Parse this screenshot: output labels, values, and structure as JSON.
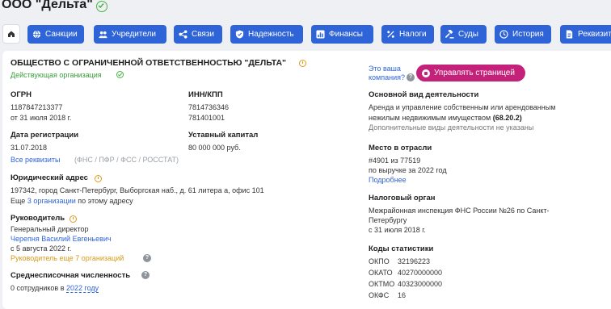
{
  "header": {
    "title": "ООО \"Дельта\""
  },
  "tabs": [
    {
      "label": "Санкции",
      "icon": "globe-icon"
    },
    {
      "label": "Учредители",
      "icon": "people-icon"
    },
    {
      "label": "Связи",
      "icon": "links-icon"
    },
    {
      "label": "Надежность",
      "icon": "shield-icon"
    },
    {
      "label": "Финансы",
      "icon": "chart-icon"
    },
    {
      "label": "Налоги",
      "icon": "percent-icon"
    },
    {
      "label": "Суды",
      "icon": "gavel-icon"
    },
    {
      "label": "История",
      "icon": "clock-icon"
    },
    {
      "label": "Реквизиты",
      "icon": "document-icon"
    }
  ],
  "company": {
    "full_name": "ОБЩЕСТВО С ОГРАНИЧЕННОЙ ОТВЕТСТВЕННОСТЬЮ \"ДЕЛЬТА\"",
    "status": "Действующая организация"
  },
  "ogrn": {
    "label": "ОГРН",
    "value": "1187847213377",
    "date": "от 31 июля 2018 г."
  },
  "inn": {
    "label": "ИНН/КПП",
    "inn": "7814736346",
    "kpp": "781401001"
  },
  "registration": {
    "label": "Дата регистрации",
    "value": "31.07.2018"
  },
  "capital": {
    "label": "Уставный капитал",
    "value": "80 000 000 руб."
  },
  "requisites": {
    "link": "Все реквизиты",
    "sources": "(ФНС / ПФР / ФСС / РОССТАТ)"
  },
  "address": {
    "label": "Юридический адрес",
    "value": "197342, город Санкт-Петербург, Выборгская наб., д. 61 литера а, офис 101",
    "more_prefix": "Еще",
    "more_link": "3 организации",
    "more_suffix": "по этому адресу"
  },
  "director": {
    "label": "Руководитель",
    "position": "Генеральный директор",
    "name": "Черепня Василий Евгеньевич",
    "since": "с 5 августа 2022 г.",
    "previous": "Руководитель еще 7 организаций"
  },
  "employees": {
    "label": "Среднесписочная численность",
    "prefix": "0 сотрудников в",
    "year_link": "2022 году"
  },
  "owner_prompt": {
    "line1": "Это ваша",
    "line2": "компания?",
    "button": "Управлять страницей"
  },
  "activity": {
    "label": "Основной вид деятельности",
    "line1": "Аренда и управление собственным или арендованным",
    "line2": "нежилым недвижимым имуществом",
    "code": "(68.20.2)",
    "additional": "Дополнительные виды деятельности не указаны"
  },
  "rank": {
    "label": "Место в отрасли",
    "value": "#4901 из 77519",
    "basis": "по выручке за 2022 год",
    "more": "Подробнее"
  },
  "tax_authority": {
    "label": "Налоговый орган",
    "line1": "Межрайонная инспекция ФНС России №26 по Санкт-",
    "line2": "Петербургу",
    "since": "с 31 июля 2018 г."
  },
  "stat_codes": {
    "label": "Коды статистики",
    "rows": [
      {
        "name": "ОКПО",
        "value": "32196223"
      },
      {
        "name": "ОКАТО",
        "value": "40270000000"
      },
      {
        "name": "ОКТМО",
        "value": "40323000000"
      },
      {
        "name": "ОКФС",
        "value": "16"
      }
    ]
  }
}
